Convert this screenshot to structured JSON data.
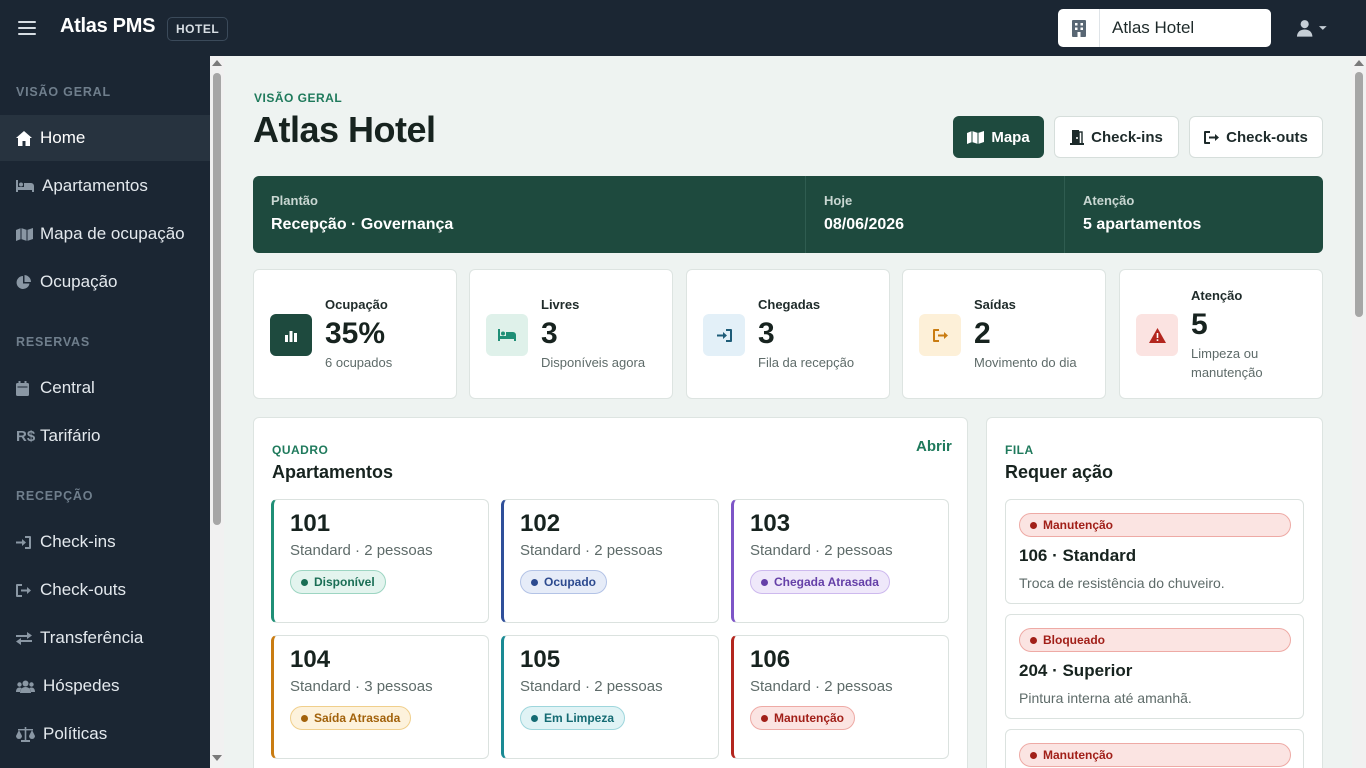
{
  "header": {
    "brand": "Atlas PMS",
    "badge": "HOTEL",
    "hotel_name": "Atlas Hotel"
  },
  "sidebar": {
    "sections": [
      {
        "label": "VISÃO GERAL",
        "items": [
          {
            "label": "Home",
            "icon": "home-icon",
            "active": true
          },
          {
            "label": "Apartamentos",
            "icon": "bed-icon"
          },
          {
            "label": "Mapa de ocupação",
            "icon": "map-icon"
          },
          {
            "label": "Ocupação",
            "icon": "pie-chart-icon"
          }
        ]
      },
      {
        "label": "RESERVAS",
        "items": [
          {
            "label": "Central",
            "icon": "calendar-icon"
          },
          {
            "label": "Tarifário",
            "icon": "currency-icon"
          }
        ]
      },
      {
        "label": "RECEPÇÃO",
        "items": [
          {
            "label": "Check-ins",
            "icon": "sign-in-icon"
          },
          {
            "label": "Check-outs",
            "icon": "sign-out-icon"
          },
          {
            "label": "Transferência",
            "icon": "transfer-icon"
          },
          {
            "label": "Hóspedes",
            "icon": "users-icon"
          },
          {
            "label": "Políticas",
            "icon": "scale-icon"
          }
        ]
      }
    ]
  },
  "page": {
    "eyebrow": "VISÃO GERAL",
    "title": "Atlas Hotel",
    "actions": {
      "map": "Mapa",
      "checkins": "Check-ins",
      "checkouts": "Check-outs"
    }
  },
  "shift": {
    "plantao_label": "Plantão",
    "plantao_value": "Recepção · Governança",
    "hoje_label": "Hoje",
    "hoje_value": "08/06/2026",
    "atencao_label": "Atenção",
    "atencao_value": "5 apartamentos"
  },
  "stats": [
    {
      "label": "Ocupação",
      "value": "35%",
      "sub": "6 ocupados",
      "icon": "bar-chart-icon"
    },
    {
      "label": "Livres",
      "value": "3",
      "sub": "Disponíveis agora",
      "icon": "bed-icon"
    },
    {
      "label": "Chegadas",
      "value": "3",
      "sub": "Fila da recepção",
      "icon": "sign-in-icon"
    },
    {
      "label": "Saídas",
      "value": "2",
      "sub": "Movimento do dia",
      "icon": "sign-out-icon"
    },
    {
      "label": "Atenção",
      "value": "5",
      "sub": "Limpeza ou manutenção",
      "icon": "warning-icon"
    }
  ],
  "board": {
    "eyebrow": "QUADRO",
    "title": "Apartamentos",
    "open_link": "Abrir",
    "rooms": [
      {
        "number": "101",
        "type": "Standard · 2 pessoas",
        "status": "Disponível",
        "color": "#1f8f76"
      },
      {
        "number": "102",
        "type": "Standard · 2 pessoas",
        "status": "Ocupado",
        "color": "#2f4f9a"
      },
      {
        "number": "103",
        "type": "Standard · 2 pessoas",
        "status": "Chegada Atrasada",
        "color": "#7d55c7"
      },
      {
        "number": "104",
        "type": "Standard · 3 pessoas",
        "status": "Saída Atrasada",
        "color": "#c97c12"
      },
      {
        "number": "105",
        "type": "Standard · 2 pessoas",
        "status": "Em Limpeza",
        "color": "#1a8a94"
      },
      {
        "number": "106",
        "type": "Standard · 2 pessoas",
        "status": "Manutenção",
        "color": "#b3261e"
      }
    ]
  },
  "queue": {
    "eyebrow": "FILA",
    "title": "Requer ação",
    "items": [
      {
        "badge": "Manutenção",
        "title": "106 · Standard",
        "desc": "Troca de resistência do chuveiro."
      },
      {
        "badge": "Bloqueado",
        "title": "204 · Superior",
        "desc": "Pintura interna até amanhã."
      },
      {
        "badge": "Manutenção",
        "title": "",
        "desc": ""
      }
    ]
  },
  "colors": {
    "sidebar_bg": "#1b2633",
    "accent": "#1e4a3e",
    "accent_text": "#1f7a5c",
    "danger": "#b3261e"
  }
}
